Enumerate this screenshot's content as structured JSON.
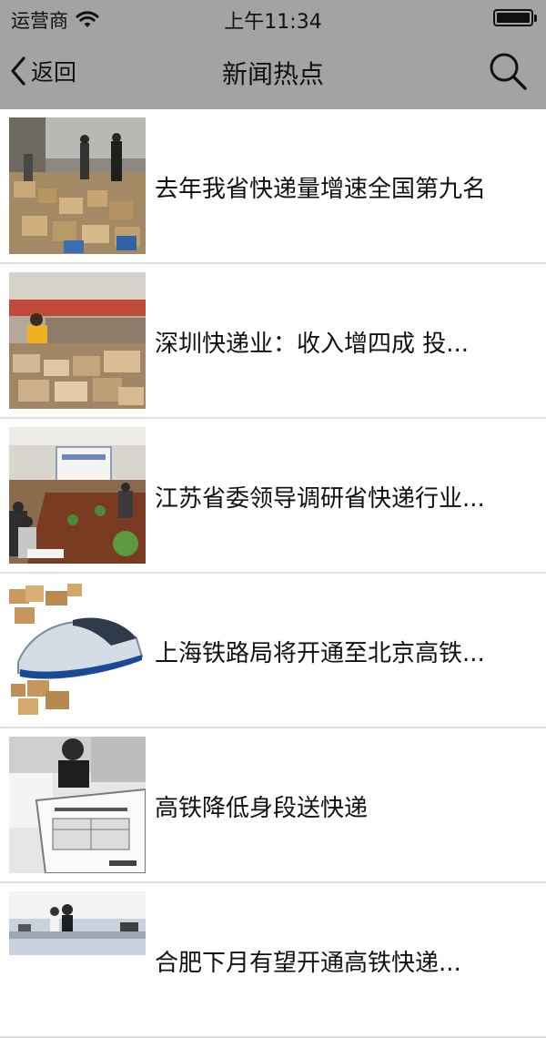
{
  "status_bar": {
    "carrier": "运营商",
    "time": "上午11:34",
    "wifi_icon": "wifi-icon",
    "battery_icon": "battery-icon"
  },
  "nav": {
    "back_label": "返回",
    "title": "新闻热点",
    "back_icon": "chevron-left-icon",
    "search_icon": "search-icon"
  },
  "news": [
    {
      "title": "去年我省快递量增速全国第九名",
      "thumb": "warehouse-parcels"
    },
    {
      "title": "深圳快递业：收入增四成 投...",
      "thumb": "sorting-worker"
    },
    {
      "title": "江苏省委领导调研省快递行业...",
      "thumb": "meeting-room"
    },
    {
      "title": "上海铁路局将开通至北京高铁...",
      "thumb": "high-speed-train"
    },
    {
      "title": "高铁降低身段送快递",
      "thumb": "express-form"
    },
    {
      "title": "合肥下月有望开通高铁快递...",
      "thumb": "office-hall"
    }
  ],
  "colors": {
    "bar": "#a3a3a3",
    "divider": "#dedede",
    "text": "#111111"
  }
}
